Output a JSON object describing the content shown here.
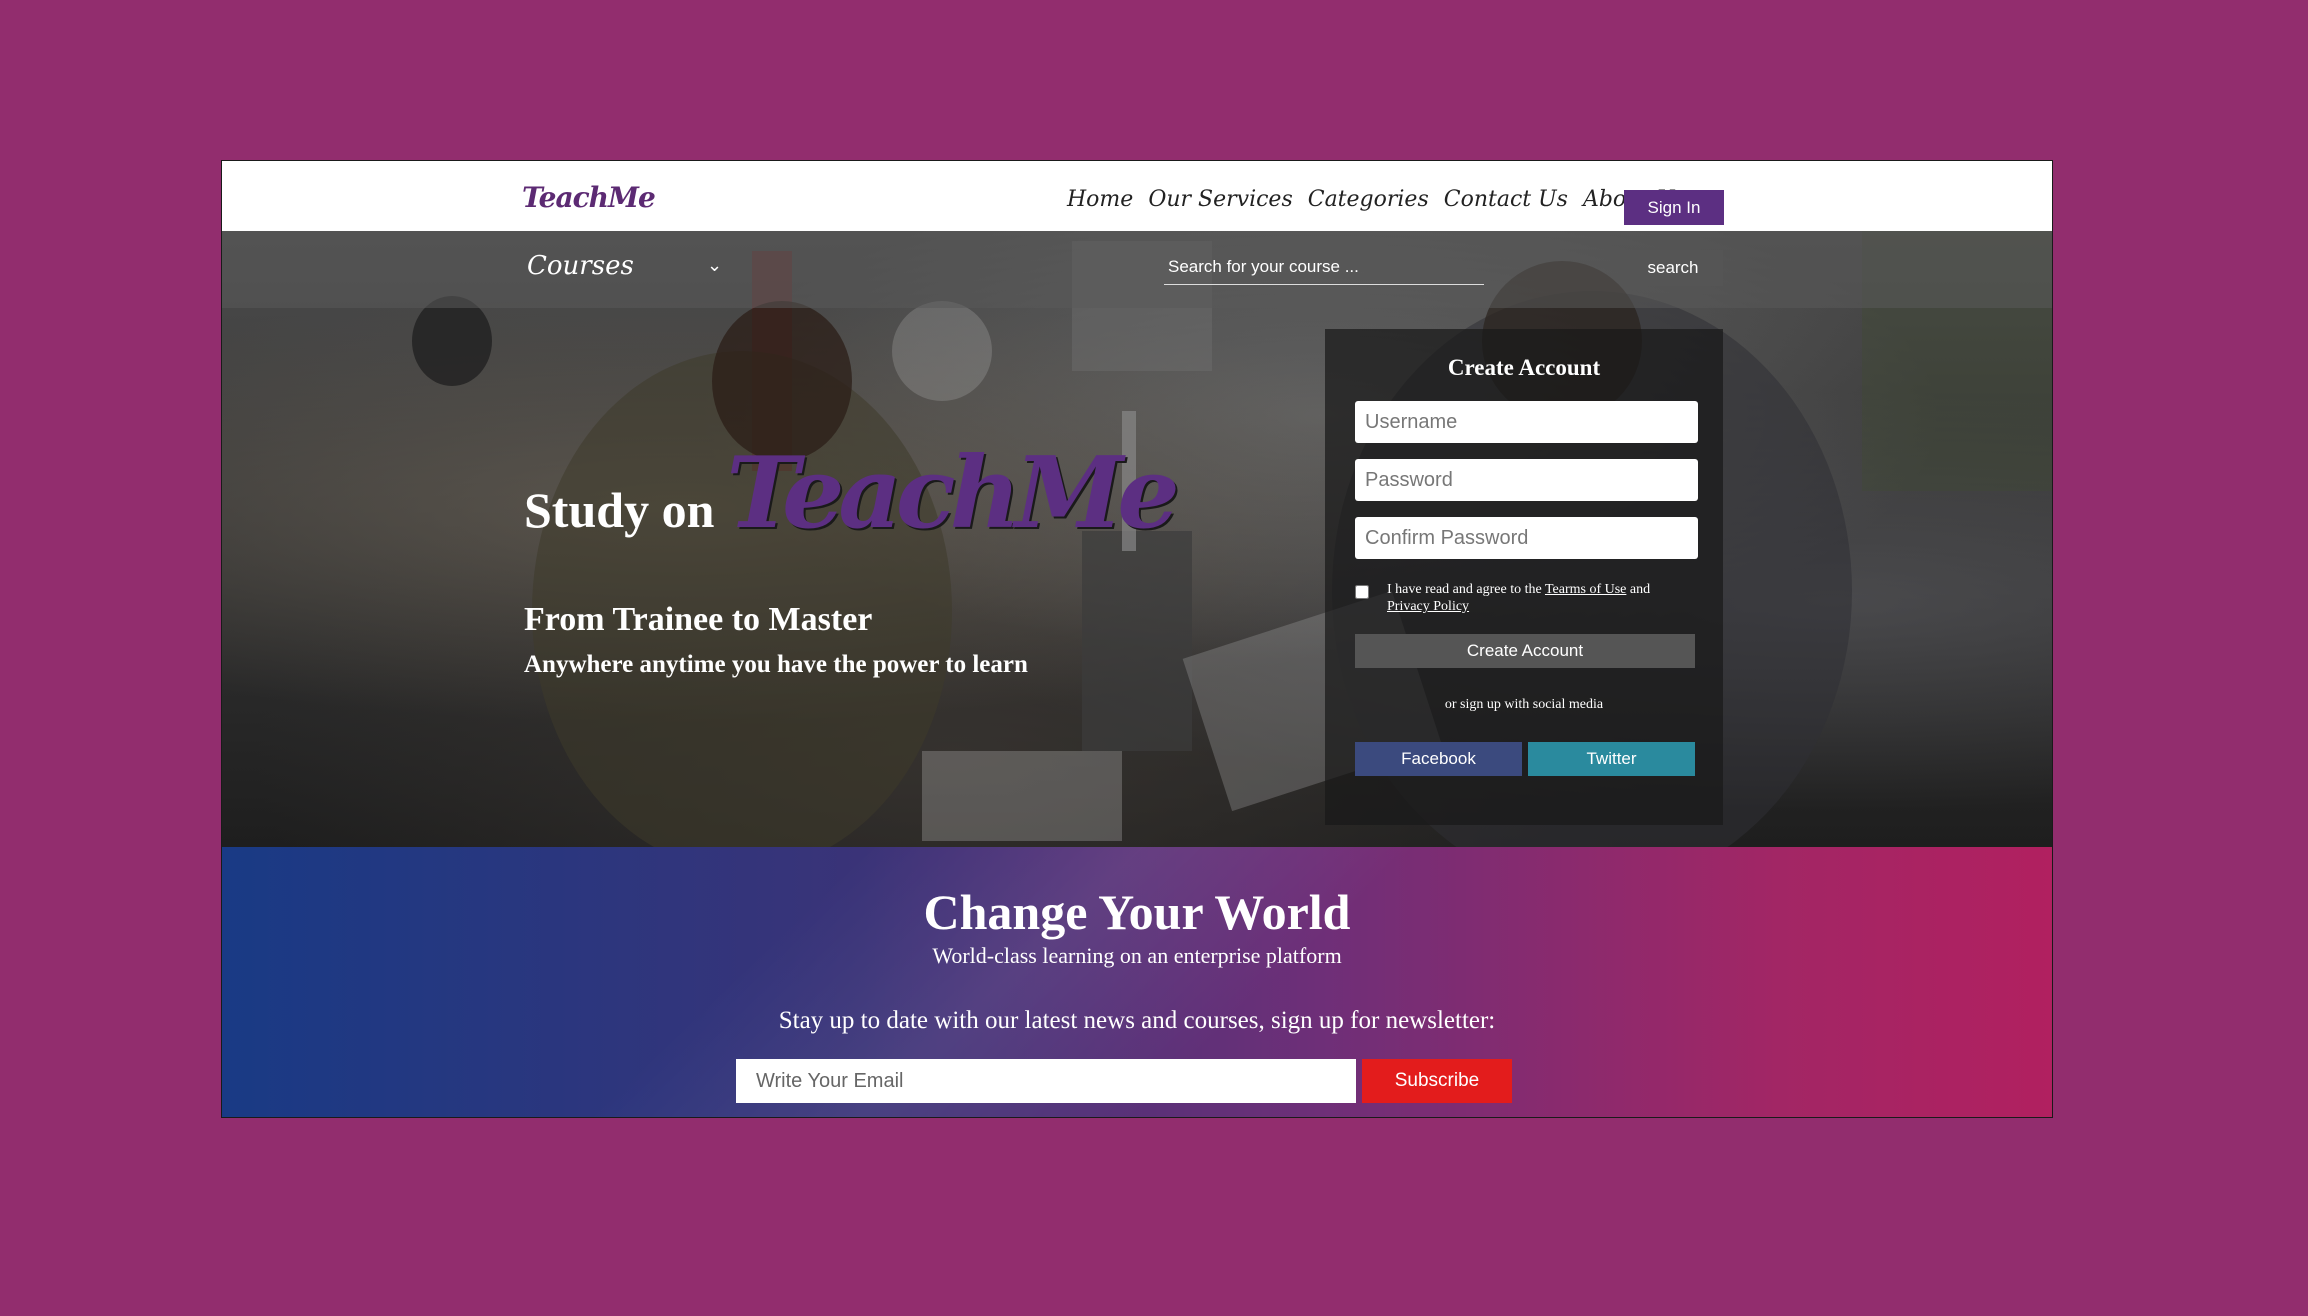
{
  "header": {
    "logo": "TeachMe",
    "nav": [
      "Home",
      "Our Services",
      "Categories",
      "Contact Us",
      "About Us"
    ],
    "signin_label": "Sign In"
  },
  "subbar": {
    "courses_label": "Courses",
    "search_placeholder": "Search for your course ...",
    "search_button": "search"
  },
  "hero": {
    "study_on": "Study on",
    "brand": "TeachMe",
    "tagline1": "From Trainee to Master",
    "tagline2": "Anywhere anytime you have the power to learn"
  },
  "signup_card": {
    "title": "Create Account",
    "username_placeholder": "Username",
    "password_placeholder": "Password",
    "confirm_placeholder": "Confirm Password",
    "terms_prefix": "I have read and agree to the",
    "terms_link": "Tearms of Use",
    "terms_and": "and",
    "privacy_link": "Privacy Policy",
    "create_button": "Create Account",
    "social_text": "or sign up with social media",
    "facebook_label": "Facebook",
    "twitter_label": "Twitter"
  },
  "newsletter": {
    "title": "Change Your World",
    "subtitle": "World-class learning on an enterprise platform",
    "prompt": "Stay up to date with our latest news and courses, sign up for newsletter:",
    "email_placeholder": "Write Your Email",
    "subscribe_label": "Subscribe"
  },
  "colors": {
    "page_background": "#922d6e",
    "brand_purple": "#5c2f82",
    "subscribe_red": "#e31c1c",
    "facebook": "#3b4a7e",
    "twitter": "#2a8a9e"
  },
  "icons": {
    "courses_dropdown": "chevron-down-icon"
  }
}
